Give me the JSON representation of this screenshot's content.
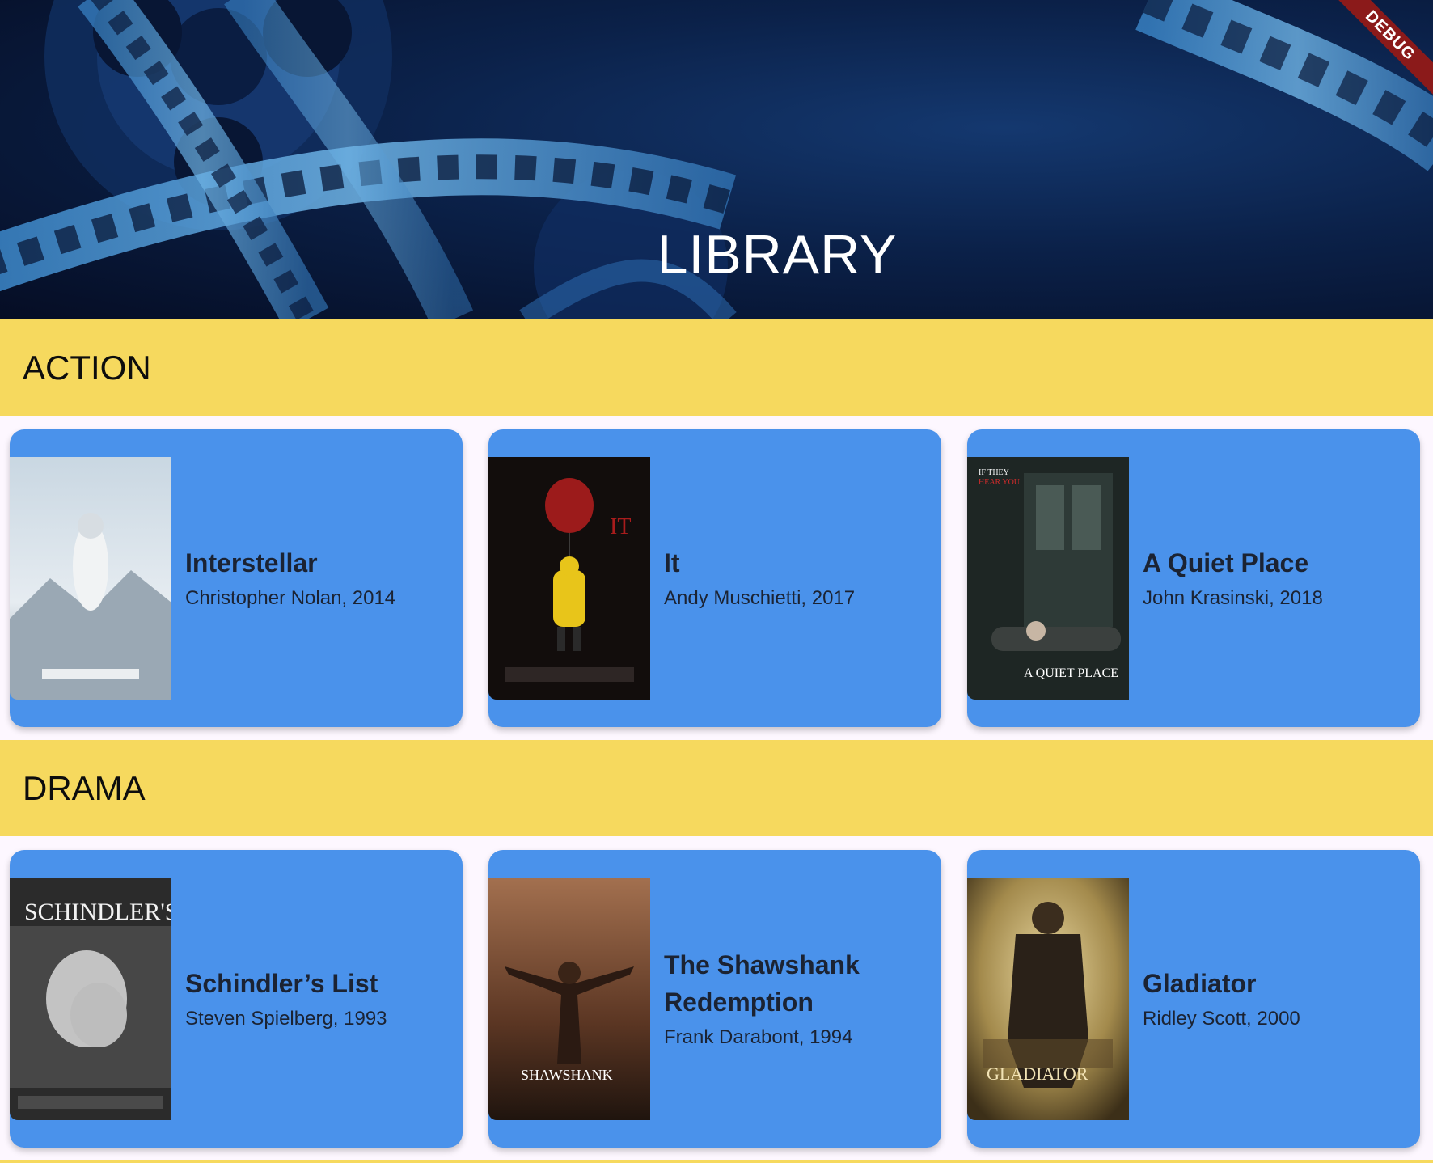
{
  "header": {
    "title": "LIBRARY",
    "debug_badge": "DEBUG"
  },
  "sections": [
    {
      "name": "ACTION",
      "movies": [
        {
          "title": "Interstellar",
          "subtitle": "Christopher Nolan, 2014"
        },
        {
          "title": "It",
          "subtitle": "Andy Muschietti, 2017"
        },
        {
          "title": "A Quiet Place",
          "subtitle": "John Krasinski, 2018"
        }
      ]
    },
    {
      "name": "DRAMA",
      "movies": [
        {
          "title": "Schindler’s List",
          "subtitle": "Steven Spielberg, 1993"
        },
        {
          "title": "The Shawshank Redemption",
          "subtitle": "Frank Darabont, 1994"
        },
        {
          "title": "Gladiator",
          "subtitle": "Ridley Scott, 2000"
        }
      ]
    }
  ],
  "colors": {
    "section_header": "#f6d95e",
    "card": "#4a92eb",
    "background": "#fdf7ff",
    "debug_ribbon": "#8b1a1a"
  }
}
